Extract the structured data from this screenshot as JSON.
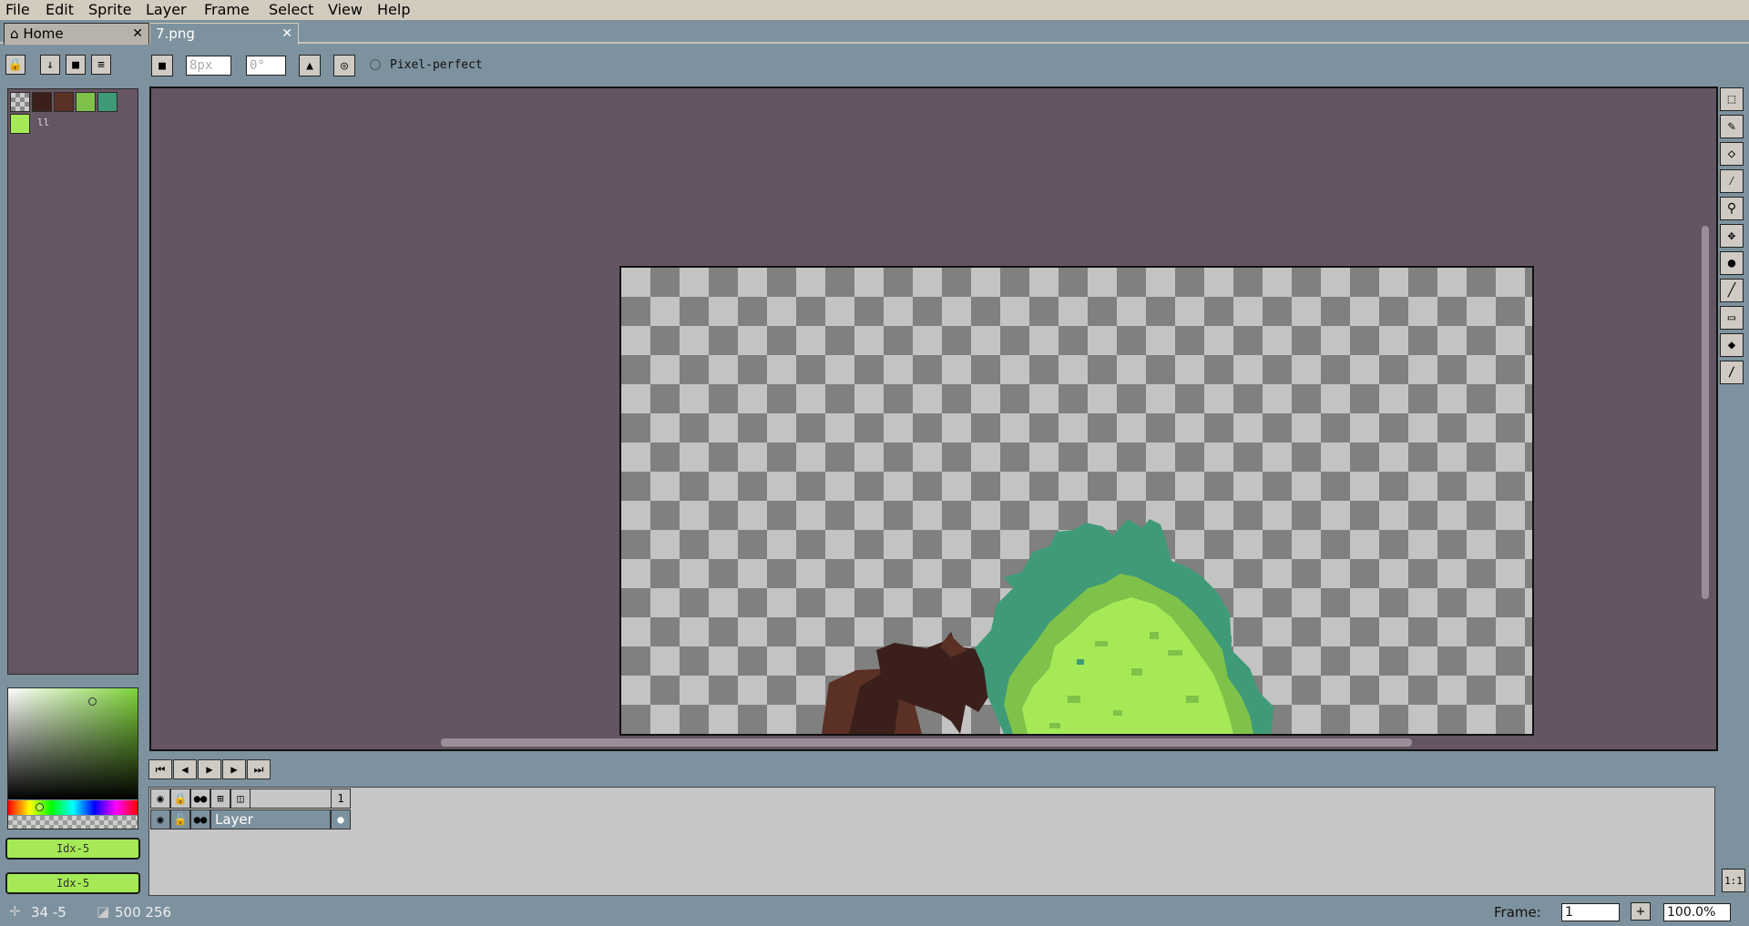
{
  "menu": [
    "File",
    "Edit",
    "Sprite",
    "Layer",
    "Frame",
    "Select",
    "View",
    "Help"
  ],
  "tabs": [
    {
      "label": "Home",
      "icon": "home-icon"
    },
    {
      "label": "7.png"
    }
  ],
  "context_bar": {
    "brush_size": "8px",
    "brush_angle": "0°",
    "pixel_perfect_label": "Pixel-perfect"
  },
  "palette": {
    "colors": [
      "transparent",
      "#3a1f1b",
      "#5b3025",
      "#7ec24a",
      "#3f9a78"
    ],
    "index_label": "ll"
  },
  "color_buttons": {
    "fg": "Idx-5",
    "bg": "Idx-5"
  },
  "timeline": {
    "frame_header": "1",
    "layer_name": "Layer"
  },
  "status": {
    "cursor": "34 -5",
    "size": "500 256",
    "frame_label": "Frame:",
    "frame_value": "1",
    "zoom": "100.0%",
    "one_to_one": "1:1"
  },
  "colors": {
    "canvas_bg": "#655562",
    "leaf_light": "#a5ea56",
    "leaf_mid": "#7ec24a",
    "leaf_dark": "#3f9a78",
    "bark_dark": "#3a1f1b",
    "bark_mid": "#5b3025"
  }
}
